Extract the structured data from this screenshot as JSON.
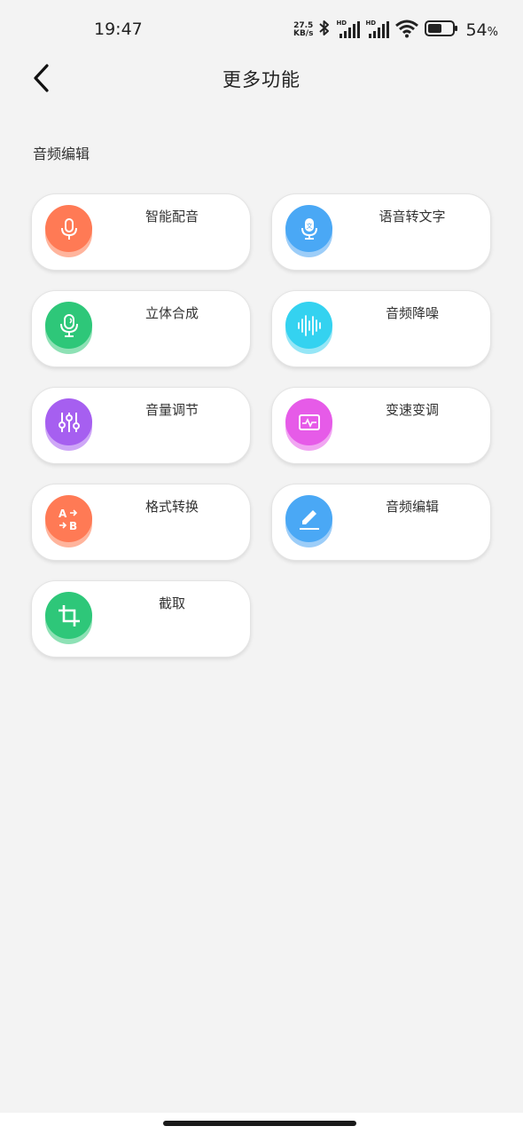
{
  "status": {
    "time": "19:47",
    "net_speed_value": "27.5",
    "net_speed_unit": "KB/s",
    "signal1_label": "HD",
    "signal2_label": "HD",
    "battery": "54",
    "battery_unit": "%"
  },
  "header": {
    "title": "更多功能"
  },
  "section": {
    "title": "音频编辑"
  },
  "features": [
    {
      "label": "智能配音",
      "icon": "microphone-icon",
      "color": "#ff7a55"
    },
    {
      "label": "语音转文字",
      "icon": "voice-to-text-icon",
      "color": "#4aa8f5"
    },
    {
      "label": "立体合成",
      "icon": "stereo-mic-icon",
      "color": "#2ec779"
    },
    {
      "label": "音频降噪",
      "icon": "waveform-icon",
      "color": "#34d2f0"
    },
    {
      "label": "音量调节",
      "icon": "equalizer-icon",
      "color": "#a65ff0"
    },
    {
      "label": "变速变调",
      "icon": "pulse-monitor-icon",
      "color": "#e65be8"
    },
    {
      "label": "格式转换",
      "icon": "a-to-b-icon",
      "color": "#ff7a55"
    },
    {
      "label": "音频编辑",
      "icon": "pencil-icon",
      "color": "#4aa8f5"
    },
    {
      "label": "截取",
      "icon": "crop-icon",
      "color": "#2ec779"
    }
  ]
}
